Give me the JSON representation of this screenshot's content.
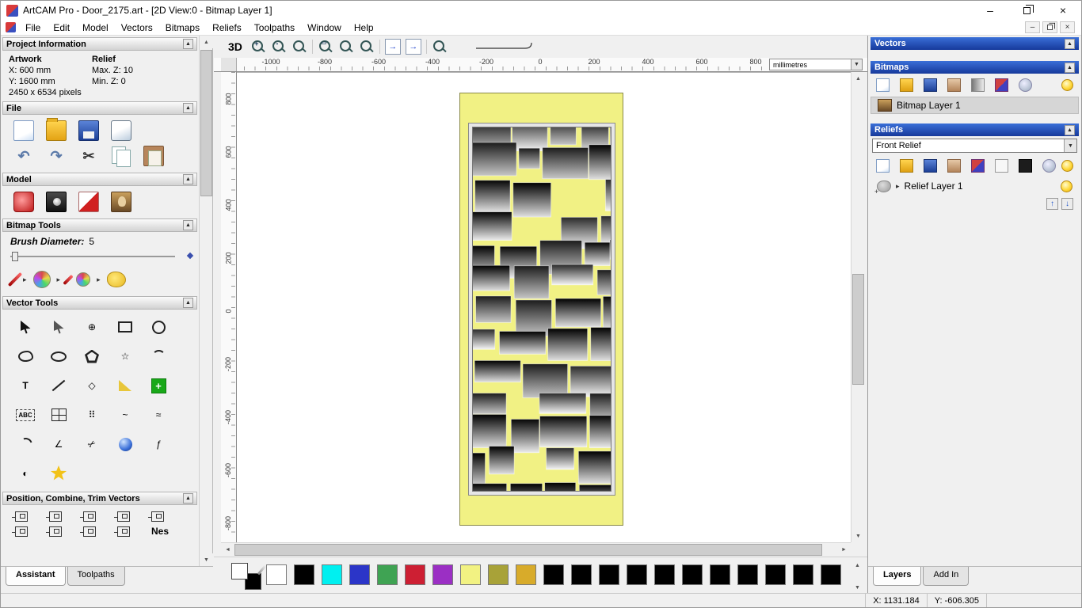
{
  "window": {
    "title": "ArtCAM Pro - Door_2175.art - [2D View:0 - Bitmap Layer 1]"
  },
  "menu": {
    "items": [
      "File",
      "Edit",
      "Model",
      "Vectors",
      "Bitmaps",
      "Reliefs",
      "Toolpaths",
      "Window",
      "Help"
    ]
  },
  "icons": {
    "collapse": "▲",
    "dropdown": "▼",
    "scroll_up": "▲",
    "scroll_down": "▼",
    "scroll_left": "◄",
    "scroll_right": "►",
    "undo": "↶",
    "redo": "↷",
    "cut": "✂",
    "flyout": "▸",
    "expander": "▸",
    "transform": "⊕",
    "star": "☆",
    "text_tool": "T",
    "diamond": "◇",
    "abc": "ABC",
    "dot_grid": "⠿",
    "wave": "~",
    "zigzag": "≈",
    "angle": "∠",
    "spline": "ƒ",
    "slice": "◐",
    "plus": "+",
    "zoom_in": "+",
    "zoom_out": "-",
    "zoom_rect": "▭",
    "layer_up": "↑",
    "layer_down": "↓",
    "arrow_right": "→",
    "minimize": "–",
    "close": "×"
  },
  "assistant": {
    "project_info": {
      "title": "Project Information",
      "col_artwork": "Artwork",
      "col_relief": "Relief",
      "artwork_x": "X: 600 mm",
      "artwork_y": "Y: 1600 mm",
      "relief_max_z": "Max. Z: 10",
      "relief_min_z": "Min. Z: 0",
      "artwork_pixels": "2450 x 6534 pixels"
    },
    "file_title": "File",
    "model_title": "Model",
    "bitmap_tools_title": "Bitmap Tools",
    "brush_diameter_label": "Brush Diameter:",
    "brush_diameter_value": "5",
    "vector_tools_title": "Vector Tools",
    "position_title": "Position, Combine, Trim Vectors",
    "nest_label": "Nes",
    "position_icons": [
      {
        "name": "align-left-icon"
      },
      {
        "name": "align-right-icon"
      },
      {
        "name": "align-top-icon"
      },
      {
        "name": "align-bottom-icon"
      },
      {
        "name": "center-in-page-icon"
      }
    ],
    "position_icons2": [
      {
        "name": "combine-union-icon"
      },
      {
        "name": "combine-subtract-icon"
      },
      {
        "name": "trim-curves-icon"
      },
      {
        "name": "node-dots-icon"
      }
    ],
    "tabs": [
      "Assistant",
      "Toolpaths"
    ]
  },
  "view_toolbar": {
    "view_3d": "3D"
  },
  "rulers": {
    "units": "millimetres",
    "h_ticks": [
      "-1000",
      "-800",
      "-600",
      "-400",
      "-200",
      "0",
      "200",
      "400",
      "600",
      "800"
    ],
    "v_ticks": [
      "800",
      "600",
      "400",
      "200",
      "0",
      "-200",
      "-400",
      "-600",
      "-800"
    ]
  },
  "door": {
    "yellow": "#f1f184",
    "frame": "#e6e6e6"
  },
  "layers_panel": {
    "vectors_title": "Vectors",
    "bitmaps_title": "Bitmaps",
    "reliefs_title": "Reliefs",
    "bitmap_layer_name": "Bitmap Layer 1",
    "relief_combo_value": "Front Relief",
    "relief_layer_name": "Relief Layer 1",
    "tabs": [
      "Layers",
      "Add In"
    ]
  },
  "palette": {
    "colors": [
      "#ffffff",
      "#000000",
      "#00f0f0",
      "#2b35c8",
      "#3fa353",
      "#cd1f33",
      "#9b2fc4",
      "#f2f282",
      "#a8a238",
      "#d8ab2a",
      "#000000",
      "#000000",
      "#000000",
      "#000000",
      "#000000",
      "#000000",
      "#000000",
      "#000000",
      "#000000",
      "#000000",
      "#000000"
    ]
  },
  "status": {
    "x": "X: 1131.184",
    "y": "Y: -606.305"
  }
}
